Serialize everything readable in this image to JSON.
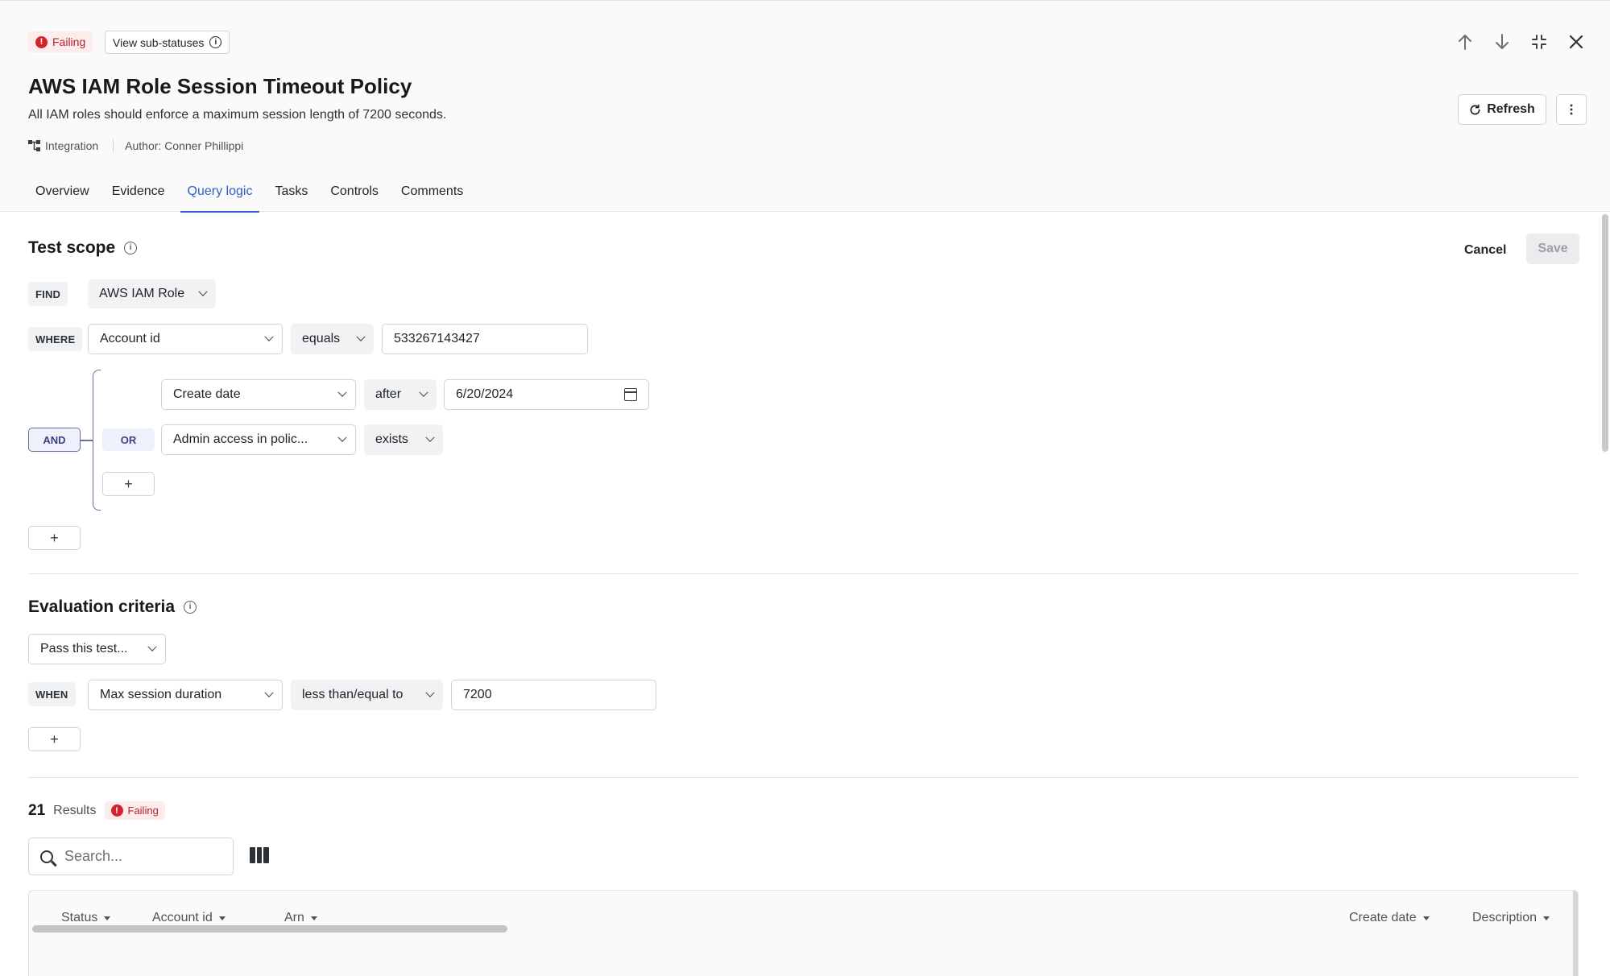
{
  "header": {
    "status_label": "Failing",
    "sub_status_button": "View sub-statuses",
    "title": "AWS IAM Role Session Timeout Policy",
    "description": "All IAM roles should enforce a maximum session length of 7200 seconds.",
    "meta_integration": "Integration",
    "meta_author": "Author: Conner Phillippi",
    "refresh_label": "Refresh",
    "top_icons": [
      "arrow-up-icon",
      "arrow-down-icon",
      "collapse-icon",
      "close-icon"
    ]
  },
  "tabs": [
    {
      "label": "Overview",
      "active": false
    },
    {
      "label": "Evidence",
      "active": false
    },
    {
      "label": "Query logic",
      "active": true
    },
    {
      "label": "Tasks",
      "active": false
    },
    {
      "label": "Controls",
      "active": false
    },
    {
      "label": "Comments",
      "active": false
    }
  ],
  "test_scope": {
    "title": "Test scope",
    "cancel_label": "Cancel",
    "save_label": "Save",
    "find_tag": "FIND",
    "find_value": "AWS IAM Role",
    "where_tag": "WHERE",
    "where_field": "Account id",
    "where_operator": "equals",
    "where_value": "533267143427",
    "and_tag": "AND",
    "or_tag": "OR",
    "cond1_field": "Create date",
    "cond1_operator": "after",
    "cond1_value": "6/20/2024",
    "cond2_field": "Admin access in polic...",
    "cond2_operator": "exists",
    "plus": "+"
  },
  "evaluation": {
    "title": "Evaluation criteria",
    "pass_select": "Pass this test...",
    "when_tag": "WHEN",
    "when_field": "Max session duration",
    "when_operator": "less than/equal to",
    "when_value": "7200",
    "plus": "+"
  },
  "results": {
    "count": "21",
    "label": "Results",
    "status": "Failing",
    "search_placeholder": "Search...",
    "columns": [
      "Status",
      "Account id",
      "Arn",
      "Create date",
      "Description"
    ]
  },
  "colors": {
    "accent": "#2f5ec4",
    "failing": "#d1242f",
    "group": "#6a6f9a"
  }
}
